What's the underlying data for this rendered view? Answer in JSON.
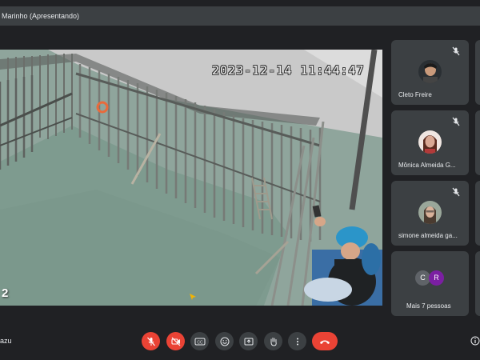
{
  "header": {
    "presenter_title": "Marinho (Apresentando)"
  },
  "stage": {
    "timestamp": "2023-12-14  11:44:47",
    "corner_number": "2"
  },
  "participants": [
    {
      "name": "Cleto Freire",
      "mic": "muted"
    },
    {
      "name": "Mônica Almeida G...",
      "mic": "muted"
    },
    {
      "name": "simone almeida ga...",
      "mic": "muted"
    }
  ],
  "more_people": {
    "label": "Mais 7 pessoas",
    "initials": [
      "C",
      "R"
    ],
    "colors": [
      "#5f6368",
      "#7b1fa2"
    ]
  },
  "self": {
    "name_fragment": "azu"
  },
  "controls": {
    "mic": "muted",
    "camera": "off",
    "captions_label": "CC",
    "buttons": [
      "mic-muted-icon",
      "camera-off-icon",
      "captions-icon",
      "emoji-icon",
      "present-icon",
      "raise-hand-icon",
      "more-options-icon",
      "hang-up-icon"
    ]
  },
  "colors": {
    "background": "#202124",
    "tile": "#3c4043",
    "danger": "#ea4335"
  }
}
